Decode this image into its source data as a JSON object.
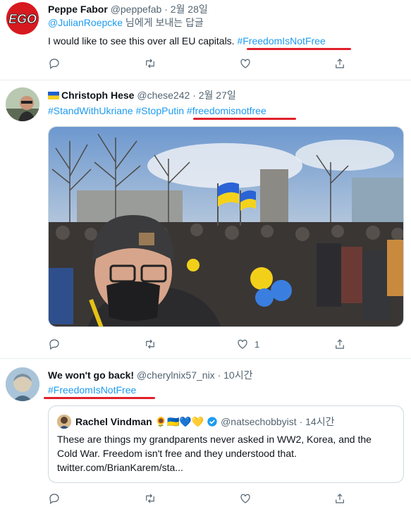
{
  "tweet1": {
    "author_name": "Peppe Fabor",
    "handle": "@peppefab",
    "dot": "·",
    "date": "2월 28일",
    "reply_to_user": "@JulianRoepcke",
    "reply_to_suffix": " 님에게 보내는 답글",
    "text": "I would like to see this over all EU capitals. ",
    "hashtag": "#FreedomIsNotFree",
    "avatar_text": "EGO"
  },
  "tweet2": {
    "author_name": "Christoph Hese",
    "handle": "@chese242",
    "dot": "·",
    "date": "2월 27일",
    "hashtag1": "#StandWithUkriane",
    "hashtag2": "#StopPutin",
    "hashtag3": "#freedomisnotfree",
    "like_count": "1"
  },
  "tweet3": {
    "author_name": "We won't go back!",
    "handle": "@cherylnix57_nix",
    "dot": "·",
    "date": "10시간",
    "hashtag": "#FreedomIsNotFree",
    "quote": {
      "author_name": "Rachel Vindman",
      "emoji": "🌻🇺🇦💙💛",
      "handle": "@natsechobbyist",
      "dot": "·",
      "date": "14시간",
      "line1": "These are things my grandparents never asked in WW2, Korea, and the",
      "line2": "Cold War. Freedom isn't free and they understood that.",
      "line3": "twitter.com/BrianKarem/sta..."
    }
  },
  "colors": {
    "link": "#1d9bf0",
    "highlight": "#e0202a",
    "muted": "#536471"
  },
  "icons": [
    "reply-icon",
    "retweet-icon",
    "like-icon",
    "share-icon",
    "verified-icon"
  ]
}
